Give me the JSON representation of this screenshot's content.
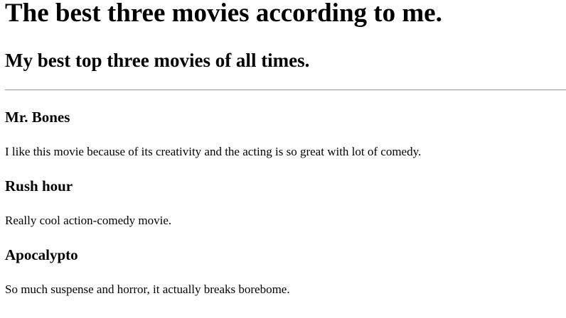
{
  "page": {
    "title": "The best three movies according to me.",
    "subtitle": "My best top three movies of all times."
  },
  "movies": [
    {
      "title": "Mr. Bones",
      "description": "I like this movie because of its creativity and the acting is so great with lot of comedy."
    },
    {
      "title": "Rush hour",
      "description": "Really cool action-comedy movie."
    },
    {
      "title": "Apocalypto",
      "description": "So much suspense and horror, it actually breaks borebome."
    }
  ]
}
